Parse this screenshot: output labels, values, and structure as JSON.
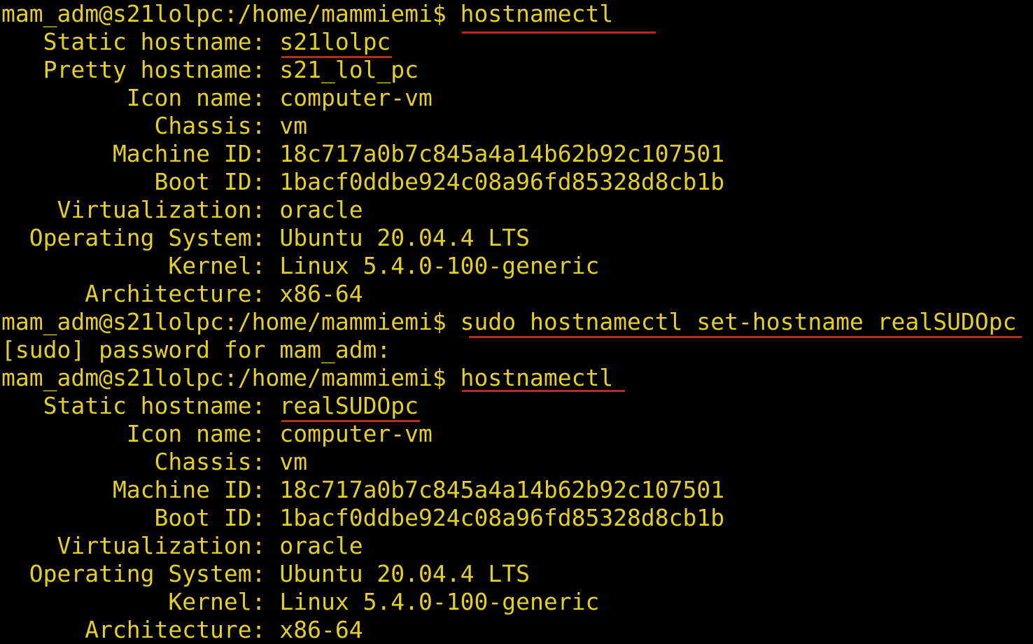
{
  "colors": {
    "background": "#000000",
    "text": "#e3ce2a",
    "underline": "#b52a1f"
  },
  "lines": [
    {
      "prompt": "mam_adm@s21lolpc:/home/mammiemi$ ",
      "command": "hostnamectl"
    },
    {
      "label": "   Static hostname: ",
      "value": "s21lolpc"
    },
    {
      "label": "   Pretty hostname: ",
      "value": "s21_lol_pc"
    },
    {
      "label": "         Icon name: ",
      "value": "computer-vm"
    },
    {
      "label": "           Chassis: ",
      "value": "vm"
    },
    {
      "label": "        Machine ID: ",
      "value": "18c717a0b7c845a4a14b62b92c107501"
    },
    {
      "label": "           Boot ID: ",
      "value": "1bacf0ddbe924c08a96fd85328d8cb1b"
    },
    {
      "label": "    Virtualization: ",
      "value": "oracle"
    },
    {
      "label": "  Operating System: ",
      "value": "Ubuntu 20.04.4 LTS"
    },
    {
      "label": "            Kernel: ",
      "value": "Linux 5.4.0-100-generic"
    },
    {
      "label": "      Architecture: ",
      "value": "x86-64"
    },
    {
      "prompt": "mam_adm@s21lolpc:/home/mammiemi$ ",
      "command": "sudo hostnamectl set-hostname realSUDOpc"
    },
    {
      "text": "[sudo] password for mam_adm:"
    },
    {
      "prompt": "mam_adm@s21lolpc:/home/mammiemi$ ",
      "command": "hostnamectl"
    },
    {
      "label": "   Static hostname: ",
      "value": "realSUDOpc"
    },
    {
      "label": "         Icon name: ",
      "value": "computer-vm"
    },
    {
      "label": "           Chassis: ",
      "value": "vm"
    },
    {
      "label": "        Machine ID: ",
      "value": "18c717a0b7c845a4a14b62b92c107501"
    },
    {
      "label": "           Boot ID: ",
      "value": "1bacf0ddbe924c08a96fd85328d8cb1b"
    },
    {
      "label": "    Virtualization: ",
      "value": "oracle"
    },
    {
      "label": "  Operating System: ",
      "value": "Ubuntu 20.04.4 LTS"
    },
    {
      "label": "            Kernel: ",
      "value": "Linux 5.4.0-100-generic"
    },
    {
      "label": "      Architecture: ",
      "value": "x86-64"
    }
  ]
}
